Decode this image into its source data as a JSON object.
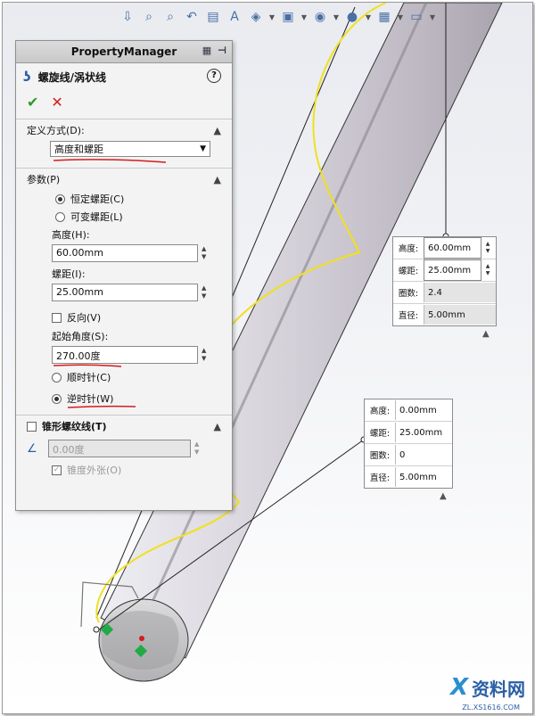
{
  "property_manager": {
    "header": "PropertyManager",
    "feature_title": "螺旋线/涡状线",
    "help_symbol": "?",
    "ok_symbol": "✔",
    "cancel_symbol": "✕",
    "define_by": {
      "label": "定义方式(D):",
      "selected": "高度和螺距"
    },
    "parameters": {
      "label": "参数(P)",
      "constant_pitch": "恒定螺距(C)",
      "variable_pitch": "可变螺距(L)",
      "height_label": "高度(H):",
      "height_value": "60.00mm",
      "pitch_label": "螺距(I):",
      "pitch_value": "25.00mm",
      "reverse_label": "反向(V)",
      "start_angle_label": "起始角度(S):",
      "start_angle_value": "270.00度",
      "clockwise_label": "顺时针(C)",
      "counterclockwise_label": "逆时针(W)"
    },
    "taper": {
      "label": "锥形螺纹线(T)",
      "angle_value": "0.00度",
      "taper_outward_label": "锥度外张(O)"
    }
  },
  "callout_top": {
    "rows": [
      {
        "label": "高度:",
        "value": "60.00mm"
      },
      {
        "label": "螺距:",
        "value": "25.00mm"
      },
      {
        "label": "圈数:",
        "value": "2.4"
      },
      {
        "label": "直径:",
        "value": "5.00mm"
      }
    ]
  },
  "callout_mid": {
    "rows": [
      {
        "label": "高度:",
        "value": "0.00mm"
      },
      {
        "label": "螺距:",
        "value": "25.00mm"
      },
      {
        "label": "圈数:",
        "value": "0"
      },
      {
        "label": "直径:",
        "value": "5.00mm"
      }
    ]
  },
  "watermark": {
    "brand": "资料网",
    "url": "ZL.XS1616.COM"
  },
  "colors": {
    "helix": "#f0e020",
    "annotation_red": "#d41c1c",
    "cylinder": "#d9d6dc"
  }
}
